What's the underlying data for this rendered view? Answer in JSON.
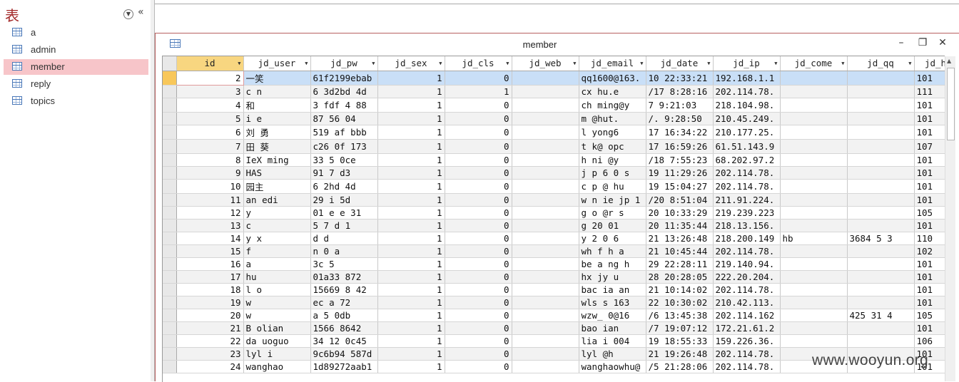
{
  "nav": {
    "title": "表",
    "items": [
      {
        "label": "a",
        "icon": "table-icon",
        "selected": false
      },
      {
        "label": "admin",
        "icon": "table-icon",
        "selected": false
      },
      {
        "label": "member",
        "icon": "table-icon",
        "selected": true
      },
      {
        "label": "reply",
        "icon": "table-icon",
        "selected": false
      },
      {
        "label": "topics",
        "icon": "table-icon",
        "selected": false
      }
    ]
  },
  "document": {
    "title": "member",
    "icon": "table-icon",
    "minimize": "–",
    "restore": "❐",
    "close": "✕"
  },
  "grid": {
    "columns": [
      "id",
      "jd_user",
      "jd_pw",
      "jd_sex",
      "jd_cls",
      "jd_web",
      "jd_email",
      "jd_date",
      "jd_ip",
      "jd_come",
      "jd_qq",
      "jd_h"
    ],
    "rows": [
      [
        "2",
        "一笑",
        "61f2199ebab",
        "1",
        "0",
        "",
        "qq1600@163.",
        "10 22:33:21",
        "192.168.1.1",
        "",
        "",
        "101"
      ],
      [
        "3",
        "c  n",
        "6 3d2bd  4d",
        "1",
        "1",
        "",
        "cx    hu.e",
        "/17 8:28:16",
        "202.114.78.",
        "",
        "",
        "111"
      ],
      [
        "4",
        "和",
        "3 fdf 4 88",
        "1",
        "0",
        "",
        "ch  ming@y",
        " 7 9:21:03",
        "218.104.98.",
        "",
        "",
        "101"
      ],
      [
        "5",
        "i  e",
        "87  56 04",
        "1",
        "0",
        "",
        "m  @hut.",
        "/. 9:28:50",
        "210.45.249.",
        "",
        "",
        "101"
      ],
      [
        "6",
        "刘 勇",
        "519  af bbb",
        "1",
        "0",
        "",
        "l  yong6",
        "17 16:34:22",
        "210.177.25.",
        "",
        "",
        "101"
      ],
      [
        "7",
        "田 葵",
        "c26  0f 173",
        "1",
        "0",
        "",
        "t k@  opc",
        "17 16:59:26",
        "61.51.143.9",
        "",
        "",
        "107"
      ],
      [
        "8",
        "IeX  ming",
        "33  5  0ce",
        "1",
        "0",
        "",
        "h  ni  @y",
        "/18 7:55:23",
        "68.202.97.2",
        "",
        "",
        "101"
      ],
      [
        "9",
        "HAS",
        "91   7  d3",
        "1",
        "0",
        "",
        "j p 6 0 s",
        "19 11:29:26",
        "202.114.78.",
        "",
        "",
        "101"
      ],
      [
        "10",
        "园主",
        "6  2hd  4d",
        "1",
        "0",
        "",
        "c p  @ hu",
        "19 15:04:27",
        "202.114.78.",
        "",
        "",
        "101"
      ],
      [
        "11",
        "  an  edi",
        "29  i  5d",
        "1",
        "0",
        "",
        "w n  ie jp 1",
        "/20 8:51:04",
        "211.91.224.",
        "",
        "",
        "101"
      ],
      [
        "12",
        "  y",
        "01  e  e 31",
        "1",
        "0",
        "",
        "g o  @r  s",
        "20 10:33:29",
        "219.239.223",
        "",
        "",
        "105"
      ],
      [
        "13",
        "  c",
        "5 7 d  1",
        "1",
        "0",
        "",
        "g  20  01",
        "20 11:35:44",
        "218.13.156.",
        "",
        "",
        "101"
      ],
      [
        "14",
        "y  x",
        "d    d",
        "1",
        "0",
        "",
        "y  2 0  6",
        "21 13:26:48",
        "218.200.149",
        "hb",
        "3684  5 3",
        "110"
      ],
      [
        "15",
        "  f",
        "n  0  a",
        "1",
        "0",
        "",
        "wh  f h  a",
        "21 10:45:44",
        "202.114.78.",
        "",
        "",
        "102"
      ],
      [
        "16",
        "  a",
        "  3c  5",
        "1",
        "0",
        "",
        "be  a ng h",
        "29 22:28:11",
        "219.140.94.",
        "",
        "",
        "101"
      ],
      [
        "17",
        "  hu",
        "01a33  872",
        "1",
        "0",
        "",
        "hx  jy  u",
        "28 20:28:05",
        "222.20.204.",
        "",
        "",
        "101"
      ],
      [
        "18",
        "l  o",
        "15669  8 42",
        "1",
        "0",
        "",
        "bac  ia  an",
        "21 10:14:02",
        "202.114.78.",
        "",
        "",
        "101"
      ],
      [
        "19",
        "w",
        "  ec  a 72",
        "1",
        "0",
        "",
        "wls  s  163",
        "22 10:30:02",
        "210.42.113.",
        "",
        "",
        "101"
      ],
      [
        "20",
        "w",
        "a  5 0db",
        "1",
        "0",
        "",
        "wzw_  0@16",
        "/6 13:45:38",
        "202.114.162",
        "",
        "425 31  4",
        "105"
      ],
      [
        "21",
        "B   olian",
        "1566  8642",
        "1",
        "0",
        "",
        "bao    ian",
        "/7 19:07:12",
        "172.21.61.2",
        "",
        "",
        "101"
      ],
      [
        "22",
        "da   uoguo",
        "34  12  0c45",
        "1",
        "0",
        "",
        "lia  i  004",
        "19 18:55:33",
        "159.226.36.",
        "",
        "",
        "106"
      ],
      [
        "23",
        "lyl  i",
        "9c6b94  587d",
        "1",
        "0",
        "",
        "lyl    @h",
        "21 19:26:48",
        "202.114.78.",
        "",
        "",
        "101"
      ],
      [
        "24",
        "wanghao",
        "1d89272aab1",
        "1",
        "0",
        "",
        "wanghaowhu@",
        "/5 21:28:06",
        "202.114.78.",
        "",
        "",
        "101"
      ]
    ]
  },
  "watermark": "www.wooyun.org",
  "colors": {
    "nav_selected": "#f7c5c9",
    "active_header": "#f8d680",
    "current_row": "#c9dff7",
    "accent_border": "#b86060"
  }
}
